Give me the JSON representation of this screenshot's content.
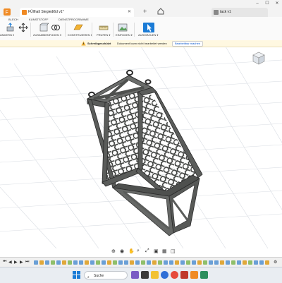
{
  "window": {
    "active_tab_title": "FÜllhalt Stegiedi6d v1*",
    "inactive_tab_title": "tack v1",
    "controls": [
      "–",
      "☐",
      "✕"
    ]
  },
  "ribbon": {
    "tabs": [
      "BLECH",
      "KUNSTSTOFF",
      "DIENSTPROGRAMME"
    ],
    "groups": [
      "ÄNDERN ▾",
      "ZUSAMMENFÜGEN ▾",
      "KONSTRUIEREN ▾",
      "PRÜFEN ▾",
      "EINFÜGEN ▾",
      "AUSWÄHLEN ▾"
    ]
  },
  "notification": {
    "title": "Schreibgeschützt",
    "message": "Dokument kann nicht bearbeitet werden",
    "action_label": "Bearbeitbar machen"
  },
  "taskbar": {
    "search_placeholder": "Suche"
  },
  "colors": {
    "accent_blue": "#1a7bd6",
    "model_fill": "#5a5c5a",
    "model_edge": "#2a2a2a",
    "grid_line": "#d9dde3"
  }
}
